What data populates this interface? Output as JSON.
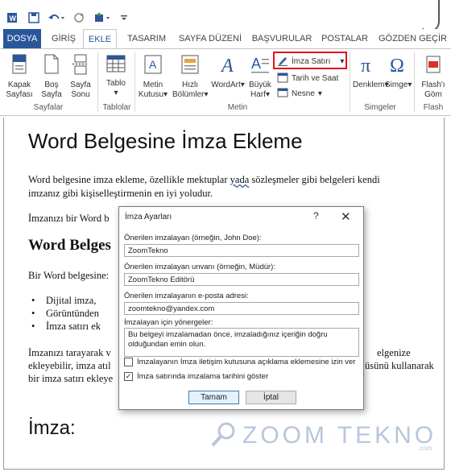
{
  "quick_access": {
    "icons": [
      "word-app-icon",
      "save-icon",
      "undo-icon",
      "redo-icon",
      "touch-mode-icon",
      "customize-icon"
    ]
  },
  "tabs": [
    "DOSYA",
    "GİRİŞ",
    "EKLE",
    "TASARIM",
    "SAYFA DÜZENİ",
    "BAŞVURULAR",
    "POSTALAR",
    "GÖZDEN GEÇİR"
  ],
  "active_tab": "EKLE",
  "ribbon": {
    "pages": {
      "cover_line1": "Kapak",
      "cover_line2": "Sayfası",
      "blank_line1": "Boş",
      "blank_line2": "Sayfa",
      "break_line1": "Sayfa",
      "break_line2": "Sonu",
      "group": "Sayfalar"
    },
    "tables": {
      "table": "Tablo",
      "group": "Tablolar"
    },
    "text": {
      "textbox_line1": "Metin",
      "textbox_line2": "Kutusu",
      "quickparts_line1": "Hızlı",
      "quickparts_line2": "Bölümler",
      "wordart": "WordArt",
      "dropcap_line1": "Büyük",
      "dropcap_line2": "Harf",
      "signature_line": "İmza Satırı",
      "date_time": "Tarih ve Saat",
      "object": "Nesne",
      "group": "Metin"
    },
    "symbols": {
      "equation": "Denklem",
      "symbol": "Simge",
      "group": "Simgeler"
    },
    "flash": {
      "line1": "Flash'ı",
      "line2": "Göm",
      "group": "Flash"
    }
  },
  "document": {
    "title": "Word Belgesine İmza Ekleme",
    "para1_line1_a": "Word belgesine imza ekleme, özellikle mektuplar ",
    "para1_line1_b": "yada",
    "para1_line1_c": "  sözleşmeler gibi belgeleri kendi",
    "para1_line2": "imzanız gibi kişiselleştirmenin en iyi yoludur.",
    "para2": "İmzanızı bir Word b",
    "heading2": "Word Belges",
    "para3": "Bir Word belgesine:",
    "bullets": [
      "Dijital imza,",
      "Görüntünden",
      "İmza satırı ek"
    ],
    "para4_line1_a": "İmzanızı tarayarak v",
    "para4_line1_b": "elgenize",
    "para4_line2_a": "ekleyebilir, imza atıl",
    "para4_line2_b": "üsünü kullanarak",
    "para4_line3": "bir imza satırı ekleye",
    "signature_label": "İmza:"
  },
  "watermark": {
    "text": "ZOOM TEKNO",
    "suffix": ".com"
  },
  "dialog": {
    "title": "İmza Ayarları",
    "help": "?",
    "close": "✕",
    "signer_label": "Önerilen imzalayan (örneğin, John Doe):",
    "signer_value": "ZoomTekno",
    "signer_title_label": "Önerilen imzalayan unvanı (örneğin, Müdür):",
    "signer_title_value": "ZoomTekno Editörü",
    "email_label": "Önerilen imzalayanın e-posta adresi:",
    "email_value": "zoomtekno@yandex.com",
    "instructions_label": "İmzalayan için yönergeler:",
    "instructions_value": "Bu belgeyi imzalamadan önce, imzaladığınız içeriğin doğru olduğundan emin olun.",
    "allow_comments_label": "İmzalayanın İmza iletişim kutusuna açıklama eklemesine izin ver",
    "allow_comments_checked": false,
    "show_date_label": "İmza satırında imzalama tarihini göster",
    "show_date_checked": true,
    "ok": "Tamam",
    "cancel": "İptal"
  },
  "colors": {
    "accent": "#2b579a",
    "highlight_box": "#e1121b"
  }
}
